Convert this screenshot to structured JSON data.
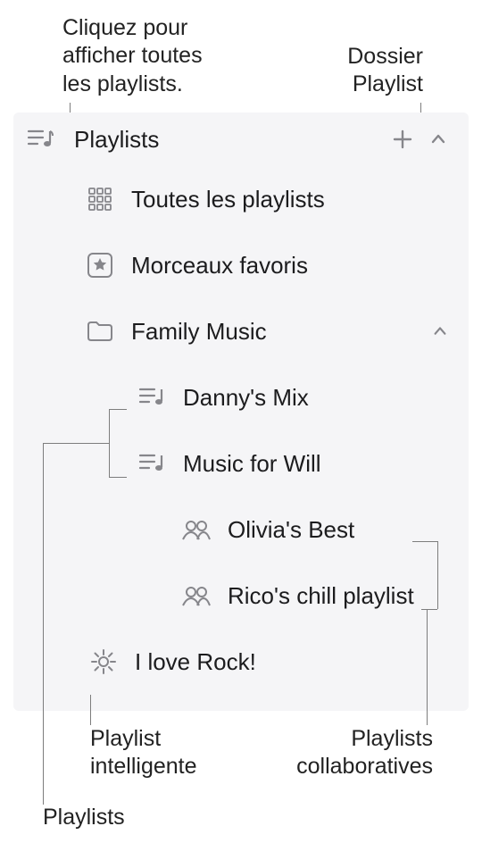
{
  "callouts": {
    "all_playlists": "Cliquez pour\nafficher toutes\nles playlists.",
    "folder": "Dossier\nPlaylist",
    "smart": "Playlist\nintelligente",
    "collab": "Playlists\ncollaboratives",
    "playlists_label": "Playlists"
  },
  "panel": {
    "header": "Playlists",
    "all": "Toutes les playlists",
    "favorites": "Morceaux favoris",
    "folder": "Family Music",
    "children": {
      "danny": "Danny's Mix",
      "will": "Music for Will",
      "olivia": "Olivia's Best",
      "rico": "Rico's chill playlist",
      "rock": "I love Rock!"
    }
  }
}
